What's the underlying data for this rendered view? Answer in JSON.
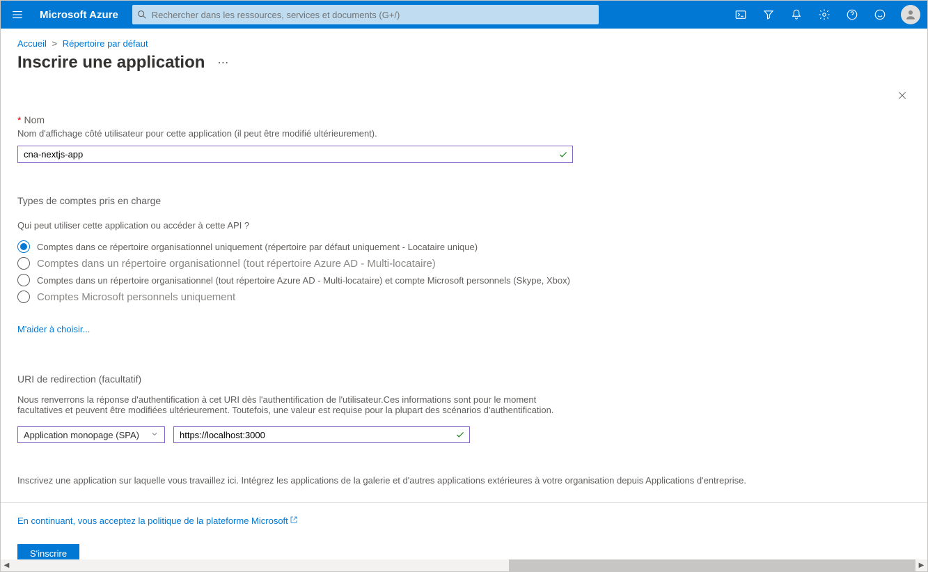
{
  "header": {
    "brand": "Microsoft Azure",
    "search_placeholder": "Rechercher dans les ressources, services et documents (G+/)"
  },
  "breadcrumbs": {
    "items": [
      "Accueil",
      "Répertoire par défaut"
    ]
  },
  "page": {
    "title": "Inscrire une application"
  },
  "form": {
    "nameLabel": "Nom",
    "nameHelp": "Nom d'affichage côté utilisateur pour cette application (il peut être modifié ultérieurement).",
    "nameValue": "cna-nextjs-app",
    "accountTypes": {
      "heading": "Types de comptes pris en charge",
      "question": "Qui peut utiliser cette application ou accéder à cette API ?",
      "options": [
        "Comptes dans ce répertoire organisationnel uniquement (répertoire par défaut uniquement - Locataire unique)",
        "Comptes dans un répertoire organisationnel (tout répertoire Azure AD - Multi-locataire)",
        "Comptes dans un répertoire organisationnel (tout répertoire Azure AD - Multi-locataire) et compte Microsoft personnels (Skype, Xbox)",
        "Comptes Microsoft personnels uniquement"
      ],
      "selected": 0,
      "helpLink": "M'aider à choisir..."
    },
    "redirect": {
      "heading": "URI de redirection (facultatif)",
      "help": "Nous renverrons la réponse d'authentification à cet URI dès l'authentification de l'utilisateur.Ces informations sont pour le moment facultatives et peuvent être modifiées ultérieurement. Toutefois, une valeur est requise pour la plupart des scénarios d'authentification.",
      "platform": "Application monopage (SPA)",
      "uri": "https://localhost:3000"
    },
    "galleryNote": "Inscrivez une application sur laquelle vous travaillez ici. Intégrez les applications de la galerie et d'autres applications extérieures à votre organisation depuis Applications d'entreprise."
  },
  "footer": {
    "consent": "En continuant, vous acceptez la politique de la plateforme Microsoft",
    "submit": "S'inscrire"
  }
}
